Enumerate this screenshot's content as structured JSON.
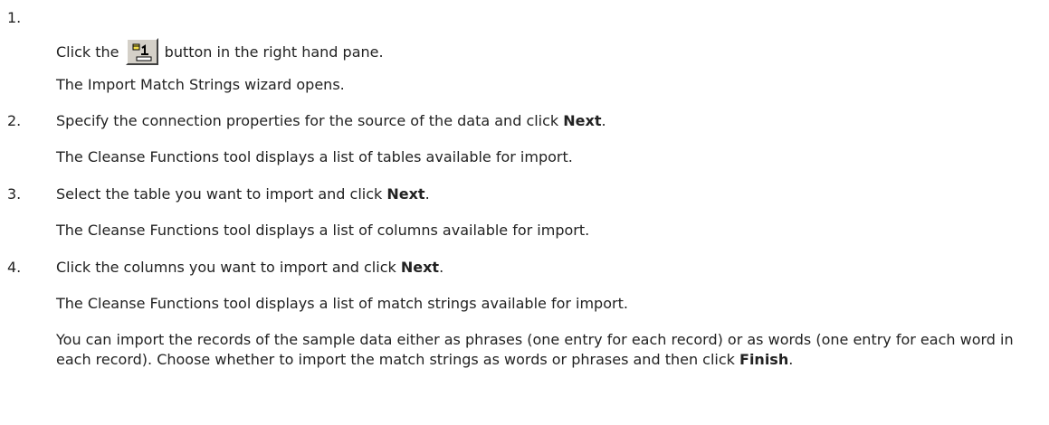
{
  "steps": [
    {
      "number": "1.",
      "line1_before": "Click the",
      "line1_after": "button in the right hand pane.",
      "icon": "import-match-strings-icon",
      "result": "The Import Match Strings wizard opens."
    },
    {
      "number": "2.",
      "text_before": "Specify the connection properties for the source of the data and click ",
      "bold": "Next",
      "text_after": ".",
      "result": "The Cleanse Functions tool displays a list of tables available for import."
    },
    {
      "number": "3.",
      "text_before": "Select the table you want to import and click ",
      "bold": "Next",
      "text_after": ".",
      "result": "The Cleanse Functions tool displays a list of columns available for import."
    },
    {
      "number": "4.",
      "text_before": "Click the columns you want to import and click ",
      "bold": "Next",
      "text_after": ".",
      "result": "The Cleanse Functions tool displays a list of match strings available for import.",
      "note_before": "You can import the records of the sample data either as phrases (one entry for each record) or as words (one entry for each word in each record). Choose whether to import the match strings as words or phrases and then click ",
      "note_bold": "Finish",
      "note_after": "."
    }
  ]
}
